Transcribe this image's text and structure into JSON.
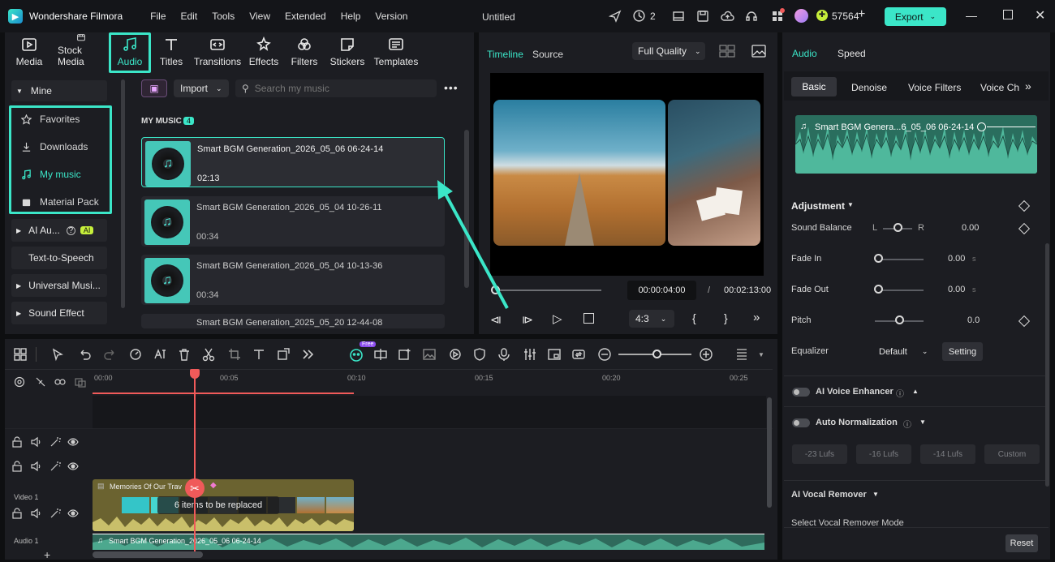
{
  "app": {
    "name": "Wondershare Filmora",
    "doc_title": "Untitled",
    "credits": "57564",
    "devices": "2",
    "export_label": "Export"
  },
  "menu": [
    "File",
    "Edit",
    "Tools",
    "View",
    "Extended",
    "Help",
    "Version"
  ],
  "top_tabs": [
    {
      "label": "Media",
      "icon": "media-icon"
    },
    {
      "label": "Stock Media",
      "icon": "stock-media-icon"
    },
    {
      "label": "Audio",
      "icon": "music-note-icon"
    },
    {
      "label": "Titles",
      "icon": "titles-icon"
    },
    {
      "label": "Transitions",
      "icon": "transitions-icon"
    },
    {
      "label": "Effects",
      "icon": "effects-icon"
    },
    {
      "label": "Filters",
      "icon": "filters-icon"
    },
    {
      "label": "Stickers",
      "icon": "stickers-icon"
    },
    {
      "label": "Templates",
      "icon": "templates-icon"
    }
  ],
  "sidebar": {
    "mine": "Mine",
    "items": [
      "Favorites",
      "Downloads",
      "My music",
      "Material Pack"
    ],
    "ai_audio": "AI Au...",
    "ai_badge": "AI",
    "tts": "Text-to-Speech",
    "universal": "Universal Musi...",
    "sound_effect": "Sound Effect"
  },
  "library": {
    "import_label": "Import",
    "search_placeholder": "Search my music",
    "section": "MY MUSIC",
    "count": "4",
    "tracks": [
      {
        "title": "Smart BGM Generation_2026_05_06 06-24-14",
        "duration": "02:13"
      },
      {
        "title": "Smart BGM Generation_2026_05_04 10-26-11",
        "duration": "00:34"
      },
      {
        "title": "Smart BGM Generation_2026_05_04 10-13-36",
        "duration": "00:34"
      },
      {
        "title": "Smart BGM Generation_2025_05_20 12-44-08",
        "duration": ""
      }
    ]
  },
  "player": {
    "tab_timeline": "Timeline",
    "tab_source": "Source",
    "quality": "Full Quality",
    "current": "00:00:04:00",
    "separator": "/",
    "total": "00:02:13:00",
    "ratio": "4:3",
    "brace_open": "{",
    "brace_close": "}"
  },
  "right": {
    "tab_audio": "Audio",
    "tab_speed": "Speed",
    "subtabs": [
      "Basic",
      "Denoise",
      "Voice Filters",
      "Voice Cha"
    ],
    "clip_name": "Smart BGM Genera...6_05_06 06-24-14",
    "adjustment": "Adjustment",
    "sound_balance": "Sound Balance",
    "l": "L",
    "r": "R",
    "balance_value": "0.00",
    "balance_level": 0.5,
    "fade_in": "Fade In",
    "fade_in_value": "0.00",
    "fade_out": "Fade Out",
    "fade_out_value": "0.00",
    "unit_s": "s",
    "pitch": "Pitch",
    "pitch_value": "0.0",
    "pitch_level": 0.5,
    "equalizer": "Equalizer",
    "eq_value": "Default",
    "setting": "Setting",
    "ai_voice": "AI Voice Enhancer",
    "auto_norm": "Auto Normalization",
    "lufs": [
      "-23 Lufs",
      "-16 Lufs",
      "-14 Lufs",
      "Custom"
    ],
    "ai_vocal": "AI Vocal Remover",
    "select_mode": "Select Vocal Remover Mode",
    "reset": "Reset"
  },
  "timeline": {
    "ticks": [
      "00:00",
      "00:05",
      "00:10",
      "00:15",
      "00:20",
      "00:25"
    ],
    "video_label": "Video 1",
    "audio_label": "Audio 1",
    "video_clip": "Memories Of Our Trav",
    "replace_label": "6 items to be replaced",
    "audio_clip": "Smart BGM Generation_2026_05_06 06-24-14",
    "free_badge": "Free"
  },
  "colors": {
    "accent": "#3be6c8",
    "export_bg": "#3be6c8",
    "playhead": "#f05a5a",
    "video_clip": "#6b6330",
    "audio_clip": "#2f6a5c"
  }
}
